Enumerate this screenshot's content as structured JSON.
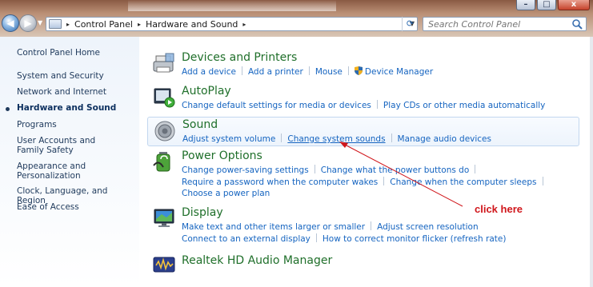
{
  "window": {
    "minimize_glyph": "–",
    "maximize_glyph": "□",
    "close_glyph": "x"
  },
  "navigation": {
    "back_glyph": "◀",
    "forward_glyph": "▶"
  },
  "address_bar": {
    "breadcrumbs": [
      "Control Panel",
      "Hardware and Sound"
    ],
    "separator_glyph": "▸"
  },
  "search": {
    "placeholder": "Search Control Panel"
  },
  "sidebar": {
    "items": [
      {
        "label": "Control Panel Home"
      },
      {
        "label": "System and Security"
      },
      {
        "label": "Network and Internet"
      },
      {
        "label": "Hardware and Sound",
        "current": true
      },
      {
        "label": "Programs"
      },
      {
        "label": "User Accounts and Family Safety"
      },
      {
        "label": "Appearance and Personalization"
      },
      {
        "label": "Clock, Language, and Region"
      },
      {
        "label": "Ease of Access"
      }
    ]
  },
  "categories": {
    "devices": {
      "title": "Devices and Printers",
      "icon": "printer-icon",
      "links": [
        "Add a device",
        "Add a printer",
        "Mouse",
        "Device Manager"
      ]
    },
    "autoplay": {
      "title": "AutoPlay",
      "icon": "autoplay-icon",
      "links": [
        "Change default settings for media or devices",
        "Play CDs or other media automatically"
      ]
    },
    "sound": {
      "title": "Sound",
      "icon": "speaker-icon",
      "links": [
        "Adjust system volume",
        "Change system sounds",
        "Manage audio devices"
      ]
    },
    "power": {
      "title": "Power Options",
      "icon": "power-icon",
      "links": [
        "Change power-saving settings",
        "Change what the power buttons do",
        "Require a password when the computer wakes",
        "Change when the computer sleeps",
        "Choose a power plan"
      ]
    },
    "display": {
      "title": "Display",
      "icon": "monitor-icon",
      "links": [
        "Make text and other items larger or smaller",
        "Adjust screen resolution",
        "Connect to an external display",
        "How to correct monitor flicker (refresh rate)"
      ]
    },
    "realtek": {
      "title": "Realtek HD Audio Manager",
      "icon": "audio-manager-icon"
    }
  },
  "annotation": {
    "text": "click here",
    "color": "#d0161b"
  },
  "colors": {
    "category_title": "#1f6f2a",
    "link": "#1564c0",
    "nav_text": "#1e395b"
  }
}
